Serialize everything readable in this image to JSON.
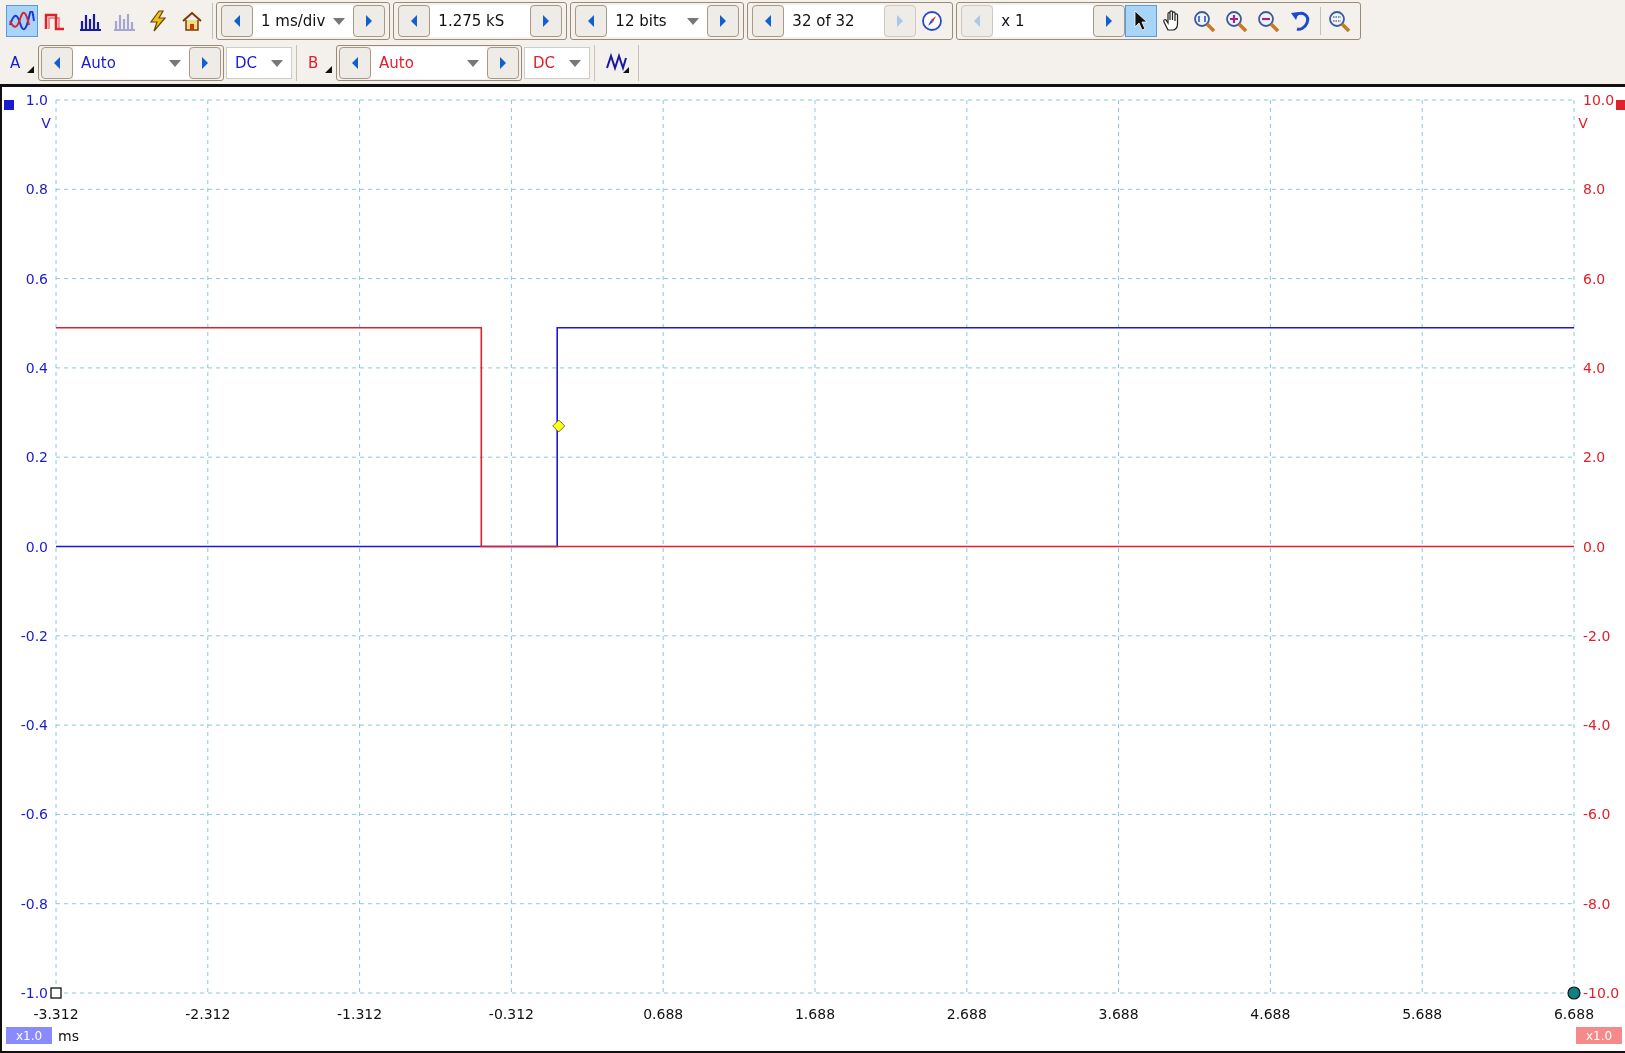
{
  "toolbar": {
    "mode_buttons": [
      {
        "selected": true,
        "disabled": false
      },
      {
        "selected": false,
        "disabled": false
      },
      {
        "selected": false,
        "disabled": false
      },
      {
        "selected": false,
        "disabled": true
      }
    ],
    "spinners": [
      {
        "value": "1 ms/div",
        "dropdown": true,
        "prev_disabled": false,
        "next_disabled": false
      },
      {
        "value": "1.275 kS",
        "dropdown": false,
        "prev_disabled": false,
        "next_disabled": false
      },
      {
        "value": "12 bits",
        "dropdown": true,
        "prev_disabled": false,
        "next_disabled": false
      },
      {
        "value": "32 of 32",
        "dropdown": false,
        "prev_disabled": false,
        "next_disabled": true
      },
      {
        "value": "x 1",
        "dropdown": false,
        "prev_disabled": true,
        "next_disabled": false
      }
    ],
    "view_tools": [
      {
        "selected": true
      },
      {
        "selected": false
      },
      {
        "selected": false
      },
      {
        "selected": false
      },
      {
        "selected": false
      },
      {
        "selected": false
      },
      {
        "selected": false
      }
    ]
  },
  "channels": [
    {
      "label": "A",
      "range": "Auto",
      "coupling": "DC",
      "color": "#1a1ad0"
    },
    {
      "label": "B",
      "range": "Auto",
      "coupling": "DC",
      "color": "#e0202a"
    }
  ],
  "scope": {
    "left_unit": "V",
    "right_unit": "V",
    "x_unit": "ms",
    "left_scale": "x1.0",
    "right_scale": "x1.0",
    "chart_data": {
      "type": "line",
      "x": [
        -3.312,
        -0.51,
        -0.51,
        -0.01,
        -0.01,
        6.688
      ],
      "series": [
        {
          "color": "#1a1ad0",
          "values": [
            0,
            0,
            0,
            0,
            0.49,
            0.49
          ]
        },
        {
          "color": "#e0202a",
          "axis": "y2",
          "values": [
            4.9,
            4.9,
            0,
            0,
            0,
            0
          ]
        }
      ],
      "grid": true,
      "xlim": [
        -3.312,
        6.688
      ],
      "ylim": [
        -1,
        1
      ],
      "y2lim": [
        -10,
        10
      ],
      "xticks": [
        {
          "value": -3.312,
          "label": "-3.312"
        },
        {
          "value": -2.312,
          "label": "-2.312"
        },
        {
          "value": -1.312,
          "label": "-1.312"
        },
        {
          "value": -0.312,
          "label": "-0.312"
        },
        {
          "value": 0.688,
          "label": "0.688"
        },
        {
          "value": 1.688,
          "label": "1.688"
        },
        {
          "value": 2.688,
          "label": "2.688"
        },
        {
          "value": 3.688,
          "label": "3.688"
        },
        {
          "value": 4.688,
          "label": "4.688"
        },
        {
          "value": 5.688,
          "label": "5.688"
        },
        {
          "value": 6.688,
          "label": "6.688"
        }
      ],
      "yticks": [
        {
          "value": 1,
          "label": "1.0"
        },
        {
          "value": 0.8,
          "label": "0.8"
        },
        {
          "value": 0.6,
          "label": "0.6"
        },
        {
          "value": 0.4,
          "label": "0.4"
        },
        {
          "value": 0.2,
          "label": "0.2"
        },
        {
          "value": 0,
          "label": "0.0"
        },
        {
          "value": -0.2,
          "label": "-0.2"
        },
        {
          "value": -0.4,
          "label": "-0.4"
        },
        {
          "value": -0.6,
          "label": "-0.6"
        },
        {
          "value": -0.8,
          "label": "-0.8"
        },
        {
          "value": -1,
          "label": "-1.0"
        }
      ],
      "y2ticks": [
        {
          "value": 10,
          "label": "10.0"
        },
        {
          "value": 8,
          "label": "8.0"
        },
        {
          "value": 6,
          "label": "6.0"
        },
        {
          "value": 4,
          "label": "4.0"
        },
        {
          "value": 2,
          "label": "2.0"
        },
        {
          "value": 0,
          "label": "0.0"
        },
        {
          "value": -2,
          "label": "-2.0"
        },
        {
          "value": -4,
          "label": "-4.0"
        },
        {
          "value": -6,
          "label": "-6.0"
        },
        {
          "value": -8,
          "label": "-8.0"
        },
        {
          "value": -10,
          "label": "-10.0"
        }
      ]
    }
  }
}
